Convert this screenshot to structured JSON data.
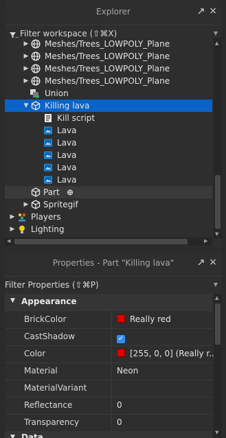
{
  "explorer": {
    "title": "Explorer",
    "undock_icon": "undock-icon",
    "close_glyph": "×",
    "filter_placeholder": "Filter workspace (⇧⌘X)",
    "filter_icon": "filter-icon",
    "rows": [
      {
        "label": "Meshes/Trees_LOWPOLY_Plane",
        "icon": "mesh-globe-icon",
        "arrow": "▶"
      },
      {
        "label": "Meshes/Trees_LOWPOLY_Plane",
        "icon": "mesh-globe-icon",
        "arrow": "▶"
      },
      {
        "label": "Meshes/Trees_LOWPOLY_Plane",
        "icon": "mesh-globe-icon",
        "arrow": "▶"
      },
      {
        "label": "Meshes/Trees_LOWPOLY_Plane",
        "icon": "mesh-globe-icon",
        "arrow": "▶"
      },
      {
        "label": "Union",
        "icon": "union-icon",
        "arrow": ""
      },
      {
        "label": "Killing lava",
        "icon": "model-icon",
        "arrow": "▼"
      },
      {
        "label": "Kill script",
        "icon": "script-icon",
        "arrow": ""
      },
      {
        "label": "Lava",
        "icon": "texture-icon",
        "arrow": ""
      },
      {
        "label": "Lava",
        "icon": "texture-icon",
        "arrow": ""
      },
      {
        "label": "Lava",
        "icon": "texture-icon",
        "arrow": ""
      },
      {
        "label": "Lava",
        "icon": "texture-icon",
        "arrow": ""
      },
      {
        "label": "Lava",
        "icon": "texture-icon",
        "arrow": ""
      },
      {
        "label": "Part",
        "icon": "part-cube-icon",
        "arrow": "",
        "add_glyph": "⊕"
      },
      {
        "label": "Spritegif",
        "icon": "model-icon",
        "arrow": "▶"
      },
      {
        "label": "Players",
        "icon": "players-icon",
        "arrow": "▶"
      },
      {
        "label": "Lighting",
        "icon": "lighting-icon",
        "arrow": "▶"
      }
    ]
  },
  "properties": {
    "title": "Properties - Part \"Killing lava\"",
    "undock_icon": "undock-icon",
    "close_glyph": "×",
    "filter_placeholder": "Filter Properties (⇧⌘P)",
    "section_label": "Appearance",
    "section2_label": "Data",
    "rows": [
      {
        "name": "BrickColor",
        "value": "Really red",
        "swatch": "#e00000"
      },
      {
        "name": "CastShadow",
        "value": "",
        "checked": true
      },
      {
        "name": "Color",
        "value": "[255, 0, 0] (Really r...",
        "swatch": "#e00000"
      },
      {
        "name": "Material",
        "value": "Neon"
      },
      {
        "name": "MaterialVariant",
        "value": ""
      },
      {
        "name": "Reflectance",
        "value": "0"
      },
      {
        "name": "Transparency",
        "value": "0"
      }
    ]
  },
  "colors": {
    "selection": "#0a63c9",
    "background": "#2e2e2e",
    "accent_red": "#e00000",
    "checkbox_blue": "#2f8fff"
  }
}
